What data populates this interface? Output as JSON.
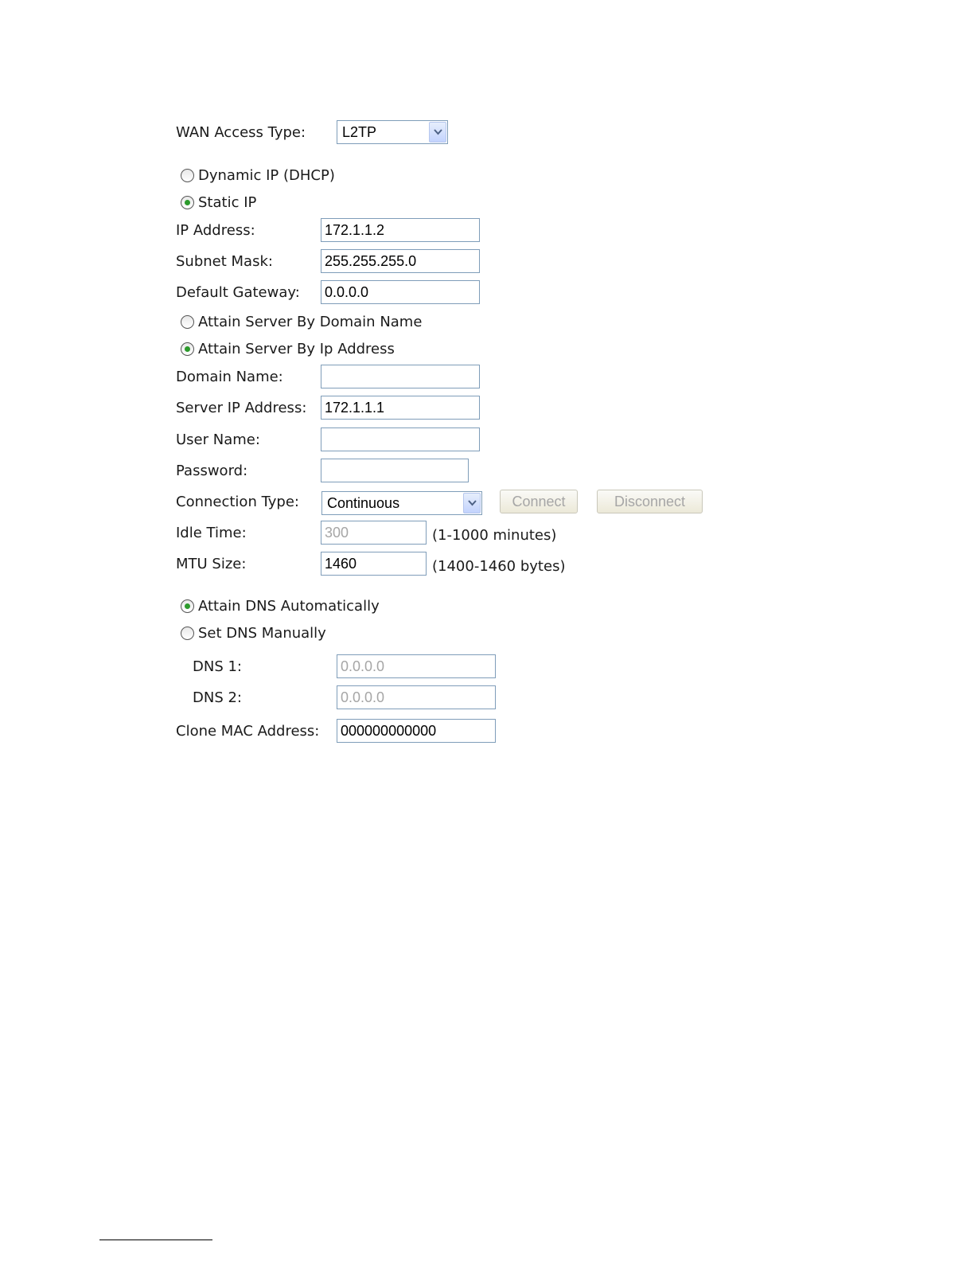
{
  "wan_access_type": {
    "label": "WAN Access Type:",
    "selected": "L2TP"
  },
  "ip_mode": {
    "options": [
      {
        "label": "Dynamic IP (DHCP)",
        "selected": false
      },
      {
        "label": "Static IP",
        "selected": true
      }
    ]
  },
  "static": {
    "ip_address": {
      "label": "IP Address:",
      "value": "172.1.1.2"
    },
    "subnet_mask": {
      "label": "Subnet Mask:",
      "value": "255.255.255.0"
    },
    "default_gateway": {
      "label": "Default Gateway:",
      "value": "0.0.0.0"
    }
  },
  "server_mode": {
    "options": [
      {
        "label": "Attain Server By Domain Name",
        "selected": false
      },
      {
        "label": "Attain Server By Ip Address",
        "selected": true
      }
    ]
  },
  "server": {
    "domain_name": {
      "label": "Domain Name:",
      "value": ""
    },
    "server_ip": {
      "label": "Server IP Address:",
      "value": "172.1.1.1"
    },
    "user_name": {
      "label": "User Name:",
      "value": ""
    },
    "password": {
      "label": "Password:",
      "value": ""
    }
  },
  "connection": {
    "label": "Connection Type:",
    "selected": "Continuous",
    "connect_label": "Connect",
    "disconnect_label": "Disconnect"
  },
  "idle_time": {
    "label": "Idle Time:",
    "value": "300",
    "hint": "(1-1000 minutes)"
  },
  "mtu": {
    "label": "MTU Size:",
    "value": "1460",
    "hint": "(1400-1460 bytes)"
  },
  "dns_mode": {
    "options": [
      {
        "label": "Attain DNS Automatically",
        "selected": true
      },
      {
        "label": "Set DNS Manually",
        "selected": false
      }
    ]
  },
  "dns": {
    "dns1": {
      "label": "DNS 1:",
      "value": "0.0.0.0"
    },
    "dns2": {
      "label": "DNS 2:",
      "value": "0.0.0.0"
    }
  },
  "clone_mac": {
    "label": "Clone MAC Address:",
    "value": "000000000000"
  },
  "colors": {
    "border": "#7f9db9",
    "radio_dot": "#2c9a2c",
    "disabled_text": "#a6a6a6"
  }
}
